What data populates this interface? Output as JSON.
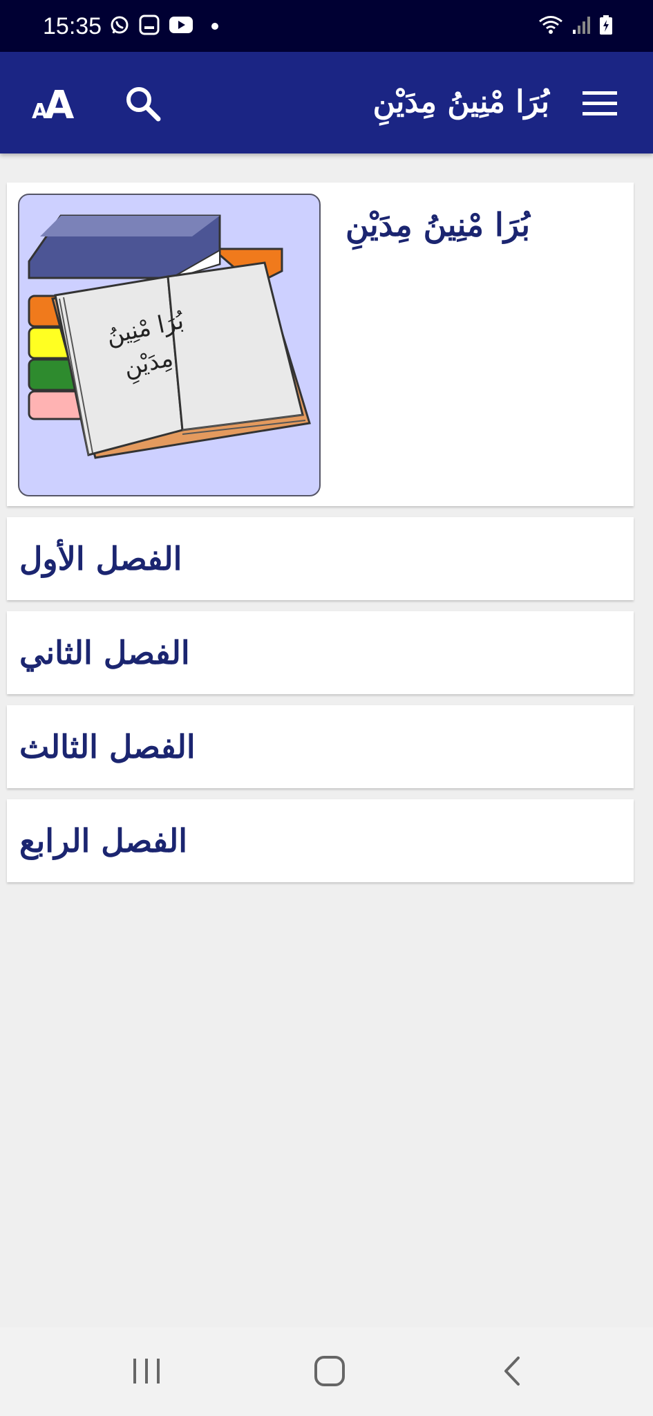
{
  "status_bar": {
    "time": "15:35",
    "notification_icons": [
      "whatsapp-icon",
      "message-icon",
      "youtube-icon"
    ],
    "system_icons": [
      "wifi-icon",
      "signal-icon",
      "battery-charging-icon"
    ]
  },
  "app_bar": {
    "title": "بُرَا مْنِينُ مِدَيْنِ",
    "actions": [
      "menu-icon",
      "search-icon",
      "font-size-icon"
    ],
    "accent_color": "#1b2584"
  },
  "book": {
    "title": "بُرَا مْنِينُ مِدَيْنِ",
    "cover_text_line1": "بُرَا مْنِينُ",
    "cover_text_line2": "مِدَيْنِ"
  },
  "chapters": [
    {
      "label": "الفصل الأول"
    },
    {
      "label": "الفصل الثاني"
    },
    {
      "label": "الفصل الثالث"
    },
    {
      "label": "الفصل الرابع"
    }
  ],
  "nav_bar": {
    "buttons": [
      "recents-icon",
      "home-icon",
      "back-icon"
    ]
  },
  "colors": {
    "status_bar": "#000033",
    "text_primary": "#1b2570",
    "background": "#efefef"
  }
}
